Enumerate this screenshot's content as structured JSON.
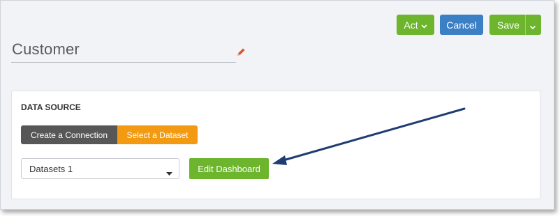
{
  "header": {
    "act_label": "Act",
    "cancel_label": "Cancel",
    "save_label": "Save"
  },
  "title": "Customer",
  "icons": {
    "edit": "pencil-icon",
    "act_dropdown": "chevron-down-icon",
    "save_dropdown": "chevron-down-icon",
    "select_dropdown": "caret-down-icon"
  },
  "data_source": {
    "section_title": "DATA SOURCE",
    "tabs": [
      {
        "label": "Create a Connection",
        "active": false
      },
      {
        "label": "Select a Dataset",
        "active": true
      }
    ],
    "dataset_select_value": "Datasets 1",
    "edit_dashboard_label": "Edit Dashboard"
  },
  "colors": {
    "green": "#6cb52d",
    "blue": "#3b7fc4",
    "orange": "#f39a13",
    "dark_tab": "#575757",
    "pencil": "#e0531f",
    "arrow": "#1f3d73"
  }
}
